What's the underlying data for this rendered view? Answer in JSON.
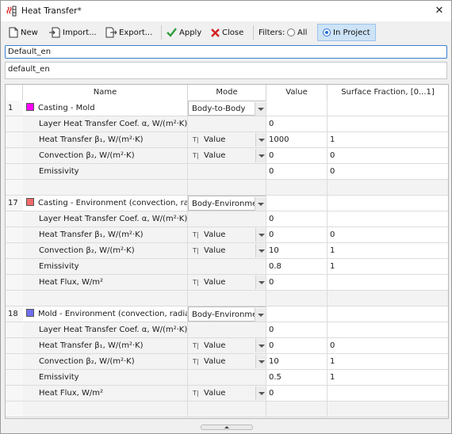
{
  "window": {
    "title": "Heat Transfer*",
    "close_glyph": "✕"
  },
  "toolbar": {
    "new_label": "New",
    "import_label": "Import...",
    "export_label": "Export...",
    "apply_label": "Apply",
    "close_label": "Close",
    "filters_label": "Filters:",
    "filter_all_label": "All",
    "filter_project_label": "In Project",
    "selected_filter": "In Project"
  },
  "fields": {
    "name_value": "Default_en",
    "description_value": "default_en"
  },
  "table": {
    "columns": [
      "Name",
      "Mode",
      "Value",
      "Surface Fraction, [0...1]"
    ],
    "groups": [
      {
        "index": "1",
        "name": "Casting - Mold",
        "color": "#ff00ff",
        "mode": "Body-to-Body",
        "rows": [
          {
            "name": "Layer Heat Transfer Coef. α, W/(m²·K)",
            "mode": "",
            "value": "0",
            "fraction": ""
          },
          {
            "name": "Heat Transfer β₁, W/(m²·K)",
            "mode": "Value",
            "value": "1000",
            "fraction": "1"
          },
          {
            "name": "Convection β₂, W/(m²·K)",
            "mode": "Value",
            "value": "0",
            "fraction": "0"
          },
          {
            "name": "Emissivity",
            "mode": "",
            "value": "0",
            "fraction": "0"
          }
        ]
      },
      {
        "index": "17",
        "name": "Casting - Environment (convection, radi...",
        "color": "#f26c6c",
        "mode": "Body-Environmen",
        "rows": [
          {
            "name": "Layer Heat Transfer Coef. α, W/(m²·K)",
            "mode": "",
            "value": "0",
            "fraction": ""
          },
          {
            "name": "Heat Transfer β₁, W/(m²·K)",
            "mode": "Value",
            "value": "0",
            "fraction": "0"
          },
          {
            "name": "Convection β₂, W/(m²·K)",
            "mode": "Value",
            "value": "10",
            "fraction": "1"
          },
          {
            "name": "Emissivity",
            "mode": "",
            "value": "0.8",
            "fraction": "1"
          },
          {
            "name": "Heat Flux, W/m²",
            "mode": "Value",
            "value": "0",
            "fraction": ""
          }
        ]
      },
      {
        "index": "18",
        "name": "Mold - Environment (convection, radiatio...",
        "color": "#6f6ff0",
        "mode": "Body-Environmen",
        "rows": [
          {
            "name": "Layer Heat Transfer Coef. α, W/(m²·K)",
            "mode": "",
            "value": "0",
            "fraction": ""
          },
          {
            "name": "Heat Transfer β₁, W/(m²·K)",
            "mode": "Value",
            "value": "0",
            "fraction": "0"
          },
          {
            "name": "Convection β₂, W/(m²·K)",
            "mode": "Value",
            "value": "10",
            "fraction": "1"
          },
          {
            "name": "Emissivity",
            "mode": "",
            "value": "0.5",
            "fraction": "1"
          },
          {
            "name": "Heat Flux, W/m²",
            "mode": "Value",
            "value": "0",
            "fraction": ""
          }
        ]
      }
    ]
  },
  "icons": {
    "title": "heat-transfer-icon",
    "new": "new-document-icon",
    "import": "import-icon",
    "export": "export-icon",
    "apply": "checkmark-icon",
    "close": "red-x-icon",
    "mode_type": "text-type-icon",
    "splitter": "collapse-arrow-icon"
  },
  "colors": {
    "apply_green": "#2e9e3a",
    "close_red": "#d42020",
    "focus_blue": "#3b80d0",
    "active_filter_bg": "#cde3f7"
  }
}
